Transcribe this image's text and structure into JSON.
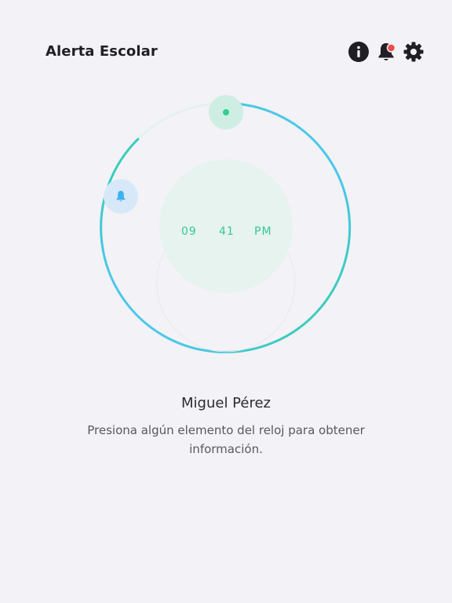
{
  "header": {
    "title": "Alerta Escolar",
    "icons": {
      "info": "info-icon",
      "notifications": "bell-icon",
      "settings": "gear-icon"
    },
    "notification_dot_color": "#ef4c4c"
  },
  "clock": {
    "hour": "09",
    "minute": "41",
    "ampm": "PM",
    "colors": {
      "ring_green": "#2fcf9a",
      "ring_blue": "#4bc7ea",
      "time_text": "#35c896"
    }
  },
  "student": {
    "name": "Miguel Pérez"
  },
  "hint": {
    "text": "Presiona algún elemento del reloj para obtener información."
  }
}
